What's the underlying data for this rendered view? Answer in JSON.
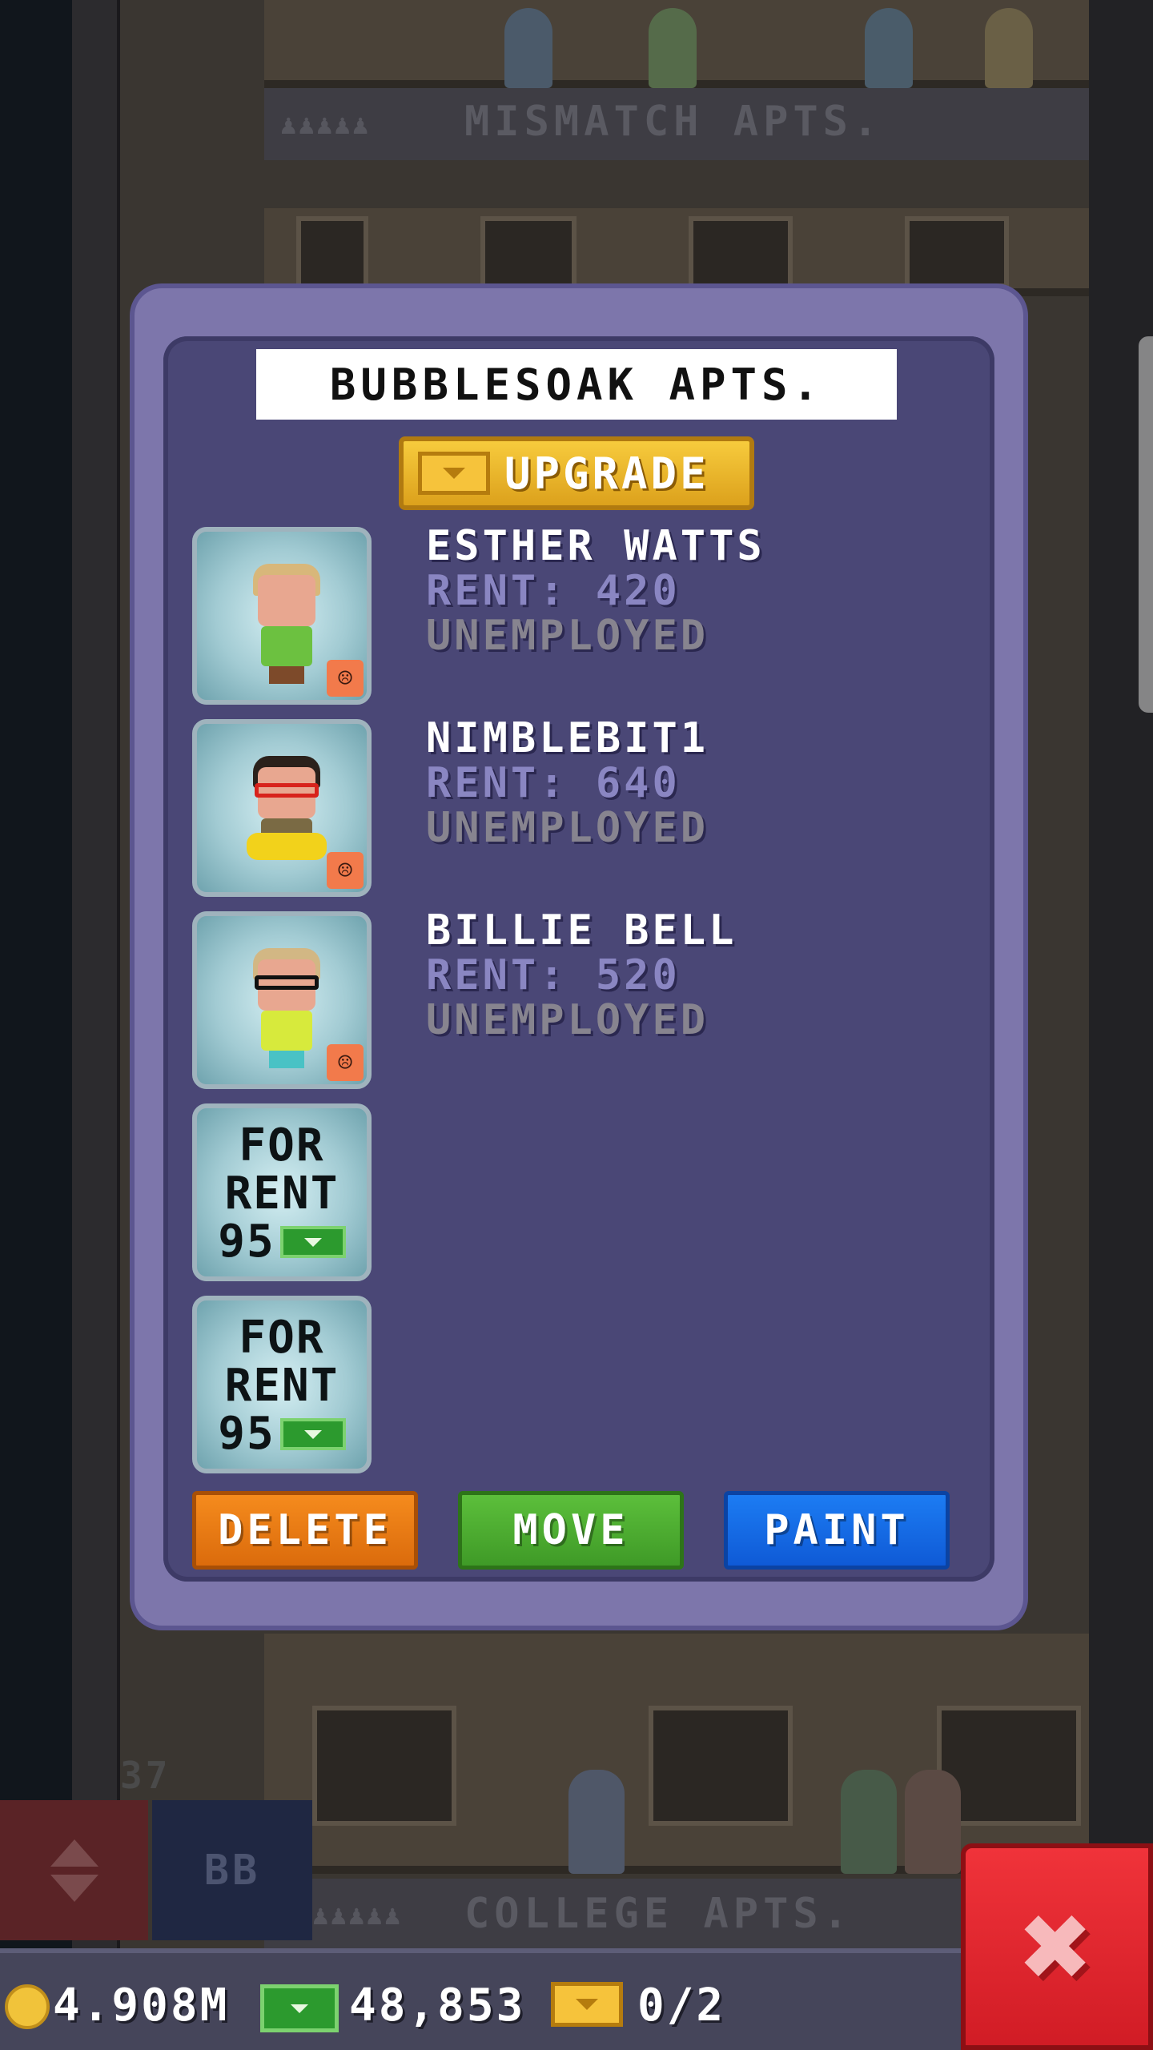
{
  "background": {
    "top_floor_label": "MISMATCH APTS.",
    "bottom_floor_label": "COLLEGE APTS.",
    "floor_number": "37",
    "elevator_label": "BB"
  },
  "dialog": {
    "title": "BUBBLESOAK APTS.",
    "upgrade_label": "UPGRADE",
    "residents": [
      {
        "name": "ESTHER WATTS",
        "rent": "RENT: 420",
        "job": "UNEMPLOYED",
        "mood": "☹"
      },
      {
        "name": "NIMBLEBIT1",
        "rent": "RENT: 640",
        "job": "UNEMPLOYED",
        "mood": "☹"
      },
      {
        "name": "BILLIE BELL",
        "rent": "RENT: 520",
        "job": "UNEMPLOYED",
        "mood": "☹"
      }
    ],
    "vacancies": [
      {
        "line1": "FOR",
        "line2": "RENT",
        "price": "95"
      },
      {
        "line1": "FOR",
        "line2": "RENT",
        "price": "95"
      }
    ],
    "buttons": {
      "delete": "DELETE",
      "move": "MOVE",
      "paint": "PAINT"
    }
  },
  "status_bar": {
    "coins": "4.908M",
    "cash": "48,853",
    "bux": "0/2"
  },
  "close_label": "✖",
  "colors": {
    "dialog_frame": "#7d76ab",
    "dialog_inner": "#4a4776",
    "upgrade_gold": "#f6c33b",
    "delete_orange": "#f58b1d",
    "move_green": "#4fae32",
    "paint_blue": "#1c7cf3",
    "close_red": "#e62a31"
  }
}
